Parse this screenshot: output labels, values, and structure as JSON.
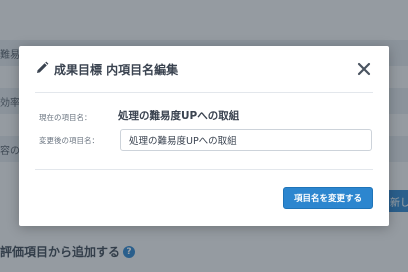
{
  "background": {
    "rows": [
      "難易度",
      "効率性",
      "容の"
    ],
    "side_button_label": "新し",
    "section_heading": "評価項目から追加する",
    "help_icon_glyph": "?"
  },
  "modal": {
    "title": "成果目標 内項目名編集",
    "current_label": "現在の項目名：",
    "current_value": "処理の難易度UPへの取組",
    "new_label": "変更後の項目名：",
    "new_value": "処理の難易度UPへの取組",
    "submit_label": "項目名を変更する"
  },
  "icons": {
    "title": "pencil-icon",
    "close": "close-icon"
  },
  "colors": {
    "accent": "#2c86cf",
    "text": "#3a4350",
    "overlay": "rgba(40,48,58,0.45)"
  }
}
